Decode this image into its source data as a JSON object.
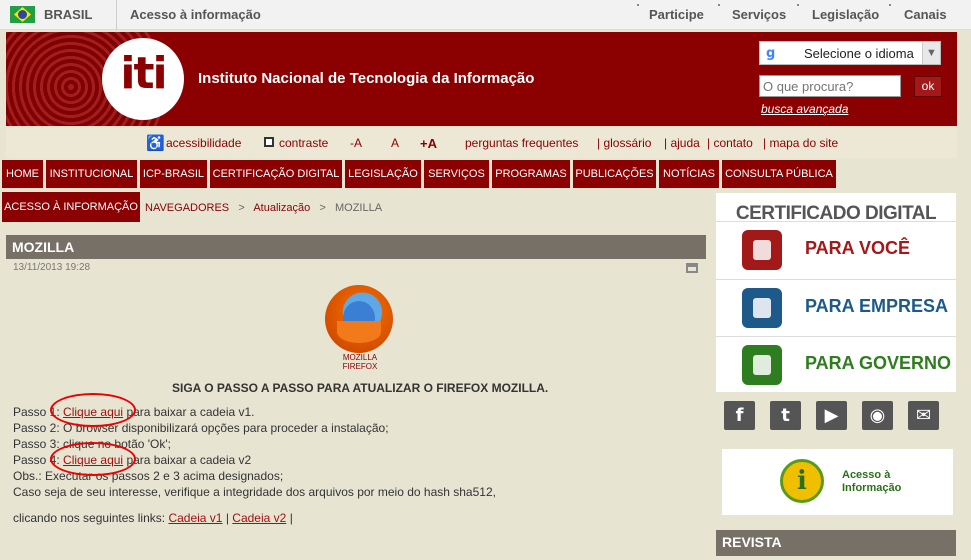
{
  "govbar": {
    "country": "BRASIL",
    "access": "Acesso à informação",
    "links": [
      "Participe",
      "Serviços",
      "Legislação",
      "Canais"
    ]
  },
  "header": {
    "logo": "iti",
    "title": "Instituto Nacional de Tecnologia da Informação",
    "language_select": "Selecione o idioma",
    "search_placeholder": "O que procura?",
    "ok": "ok",
    "advanced": "busca avançada"
  },
  "toolbar": {
    "accessibility": "acessibilidade",
    "contrast": "contraste",
    "font_minus": "-A",
    "font_normal": "A",
    "font_plus": "+A",
    "links": [
      "perguntas frequentes",
      "| glossário",
      "| ajuda",
      "| contato",
      "| mapa do site"
    ]
  },
  "nav": {
    "items": [
      "HOME",
      "INSTITUCIONAL",
      "ICP-BRASIL",
      "CERTIFICAÇÃO DIGITAL",
      "LEGISLAÇÃO",
      "SERVIÇOS",
      "PROGRAMAS",
      "PUBLICAÇÕES",
      "NOTÍCIAS",
      "CONSULTA PÚBLICA"
    ],
    "second": "ACESSO À INFORMAÇÃO"
  },
  "breadcrumb": {
    "a": "NAVEGADORES",
    "sep": ">",
    "b": "Atualização",
    "c": "MOZILLA"
  },
  "article": {
    "title": "MOZILLA",
    "date": "13/11/2013 19:28",
    "logo_label": "MOZILLA FIREFOX",
    "headline": "SIGA O PASSO A PASSO PARA ATUALIZAR O FIREFOX MOZILLA.",
    "step1_pre": "Passo 1:",
    "step1_link": "Clique aqui",
    "step1_post": "para baixar a cadeia v1.",
    "step2": "Passo 2: O browser disponibilizará opções para proceder a instalação;",
    "step3": "Passo 3: clique no botão 'Ok';",
    "step4_pre": "Passo 4:",
    "step4_link": "Clique aqui",
    "step4_post": "para baixar a cadeia v2",
    "obs": "Obs.: Executar os passos 2 e 3 acima designados;",
    "verify": "Caso seja de seu interesse, verifique a integridade dos arquivos por meio do hash sha512,",
    "links_pre": "clicando nos seguintes links:",
    "link_v1": "Cadeia v1",
    "sep": "|",
    "link_v2": "Cadeia v2",
    "end": "|"
  },
  "sidebar": {
    "heading": "CERTIFICADO DIGITAL",
    "cards": [
      {
        "label": "PARA VOCÊ",
        "color": "#a31818"
      },
      {
        "label": "PARA EMPRESA",
        "color": "#1d5a8a"
      },
      {
        "label": "PARA GOVERNO",
        "color": "#2e7d1e"
      }
    ],
    "social": [
      "f",
      "t",
      "▶",
      "◉",
      "✉"
    ],
    "access_label_1": "Acesso à",
    "access_label_2": "Informação",
    "access_icon": "i",
    "revista": "REVISTA"
  }
}
